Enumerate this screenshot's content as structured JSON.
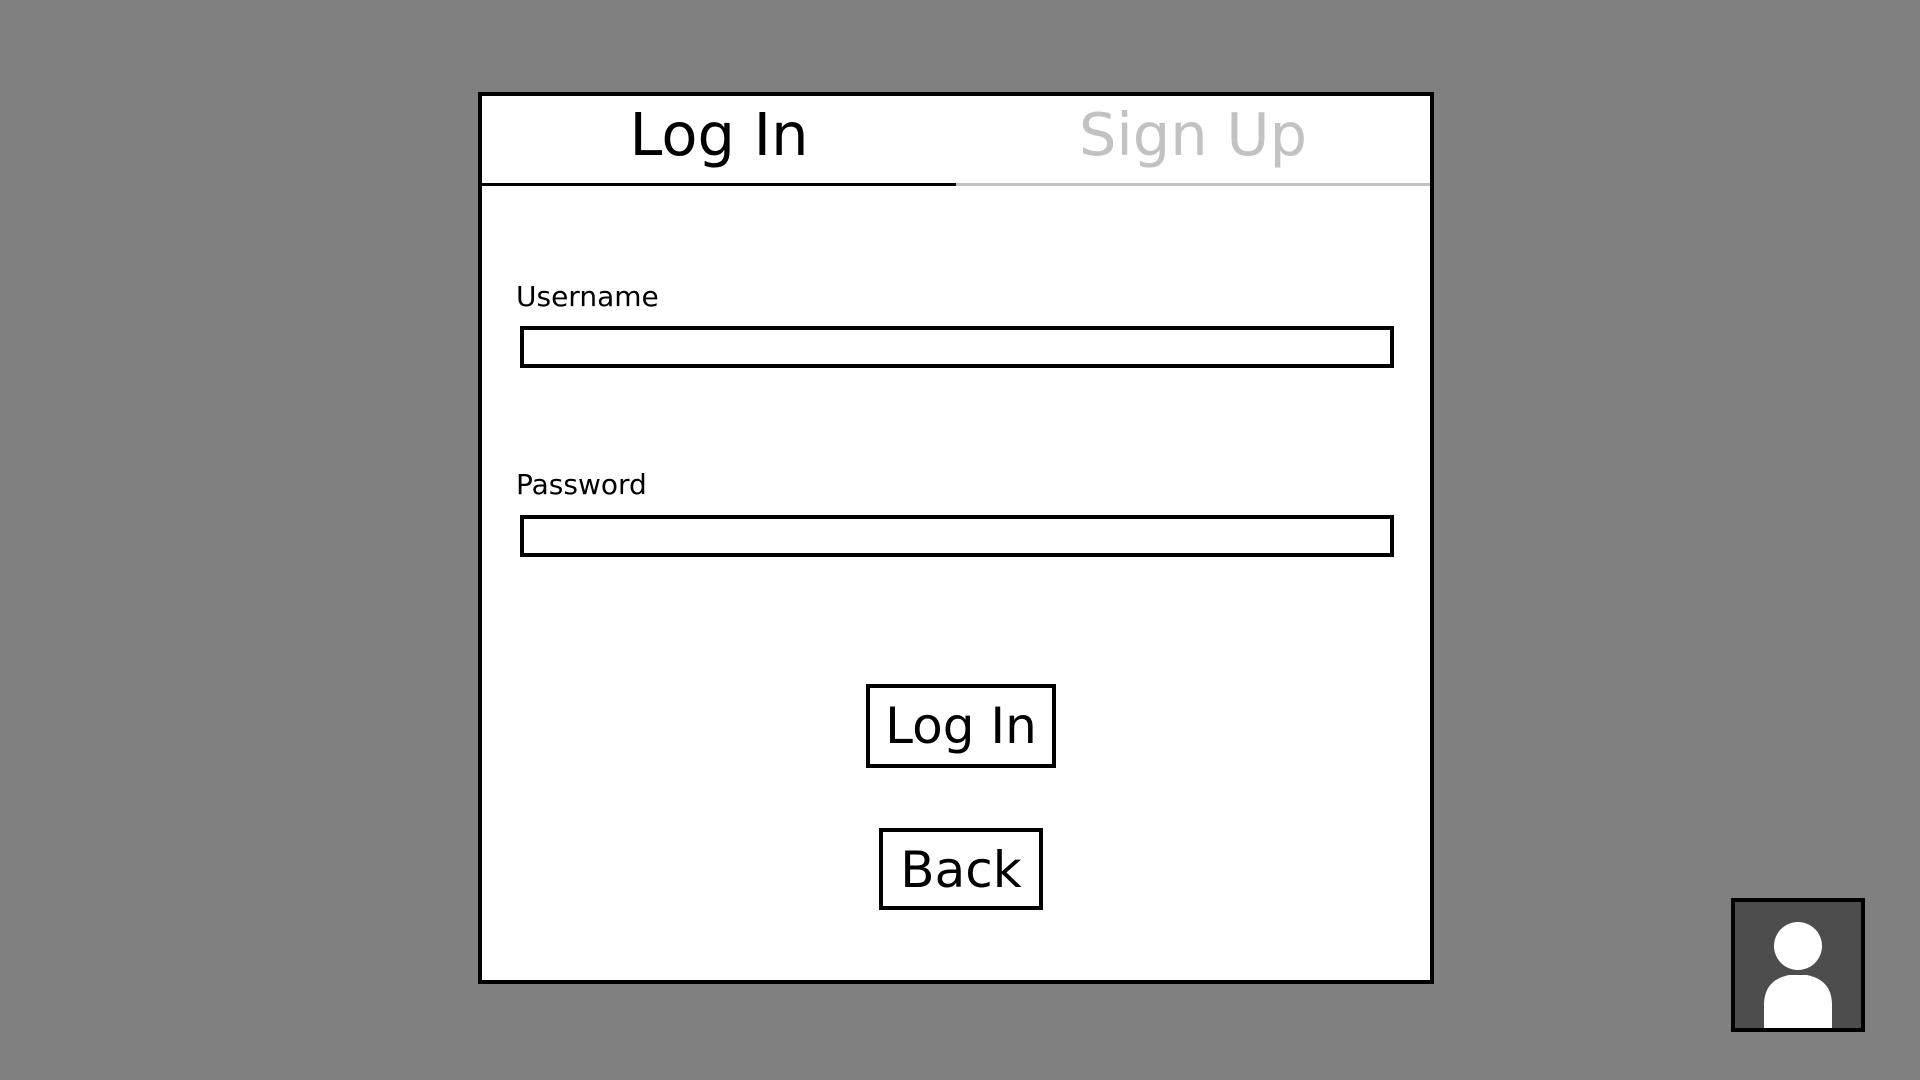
{
  "tabs": {
    "login_label": "Log In",
    "signup_label": "Sign Up",
    "active": "login"
  },
  "form": {
    "username_label": "Username",
    "username_value": "",
    "password_label": "Password",
    "password_value": ""
  },
  "buttons": {
    "login_label": "Log In",
    "back_label": "Back"
  },
  "avatar": {
    "icon": "user-avatar-icon"
  },
  "colors": {
    "background": "#808080",
    "panel": "#ffffff",
    "border": "#000000",
    "inactive_tab": "#c2c2c2",
    "avatar_bg": "#4d4d4d"
  }
}
